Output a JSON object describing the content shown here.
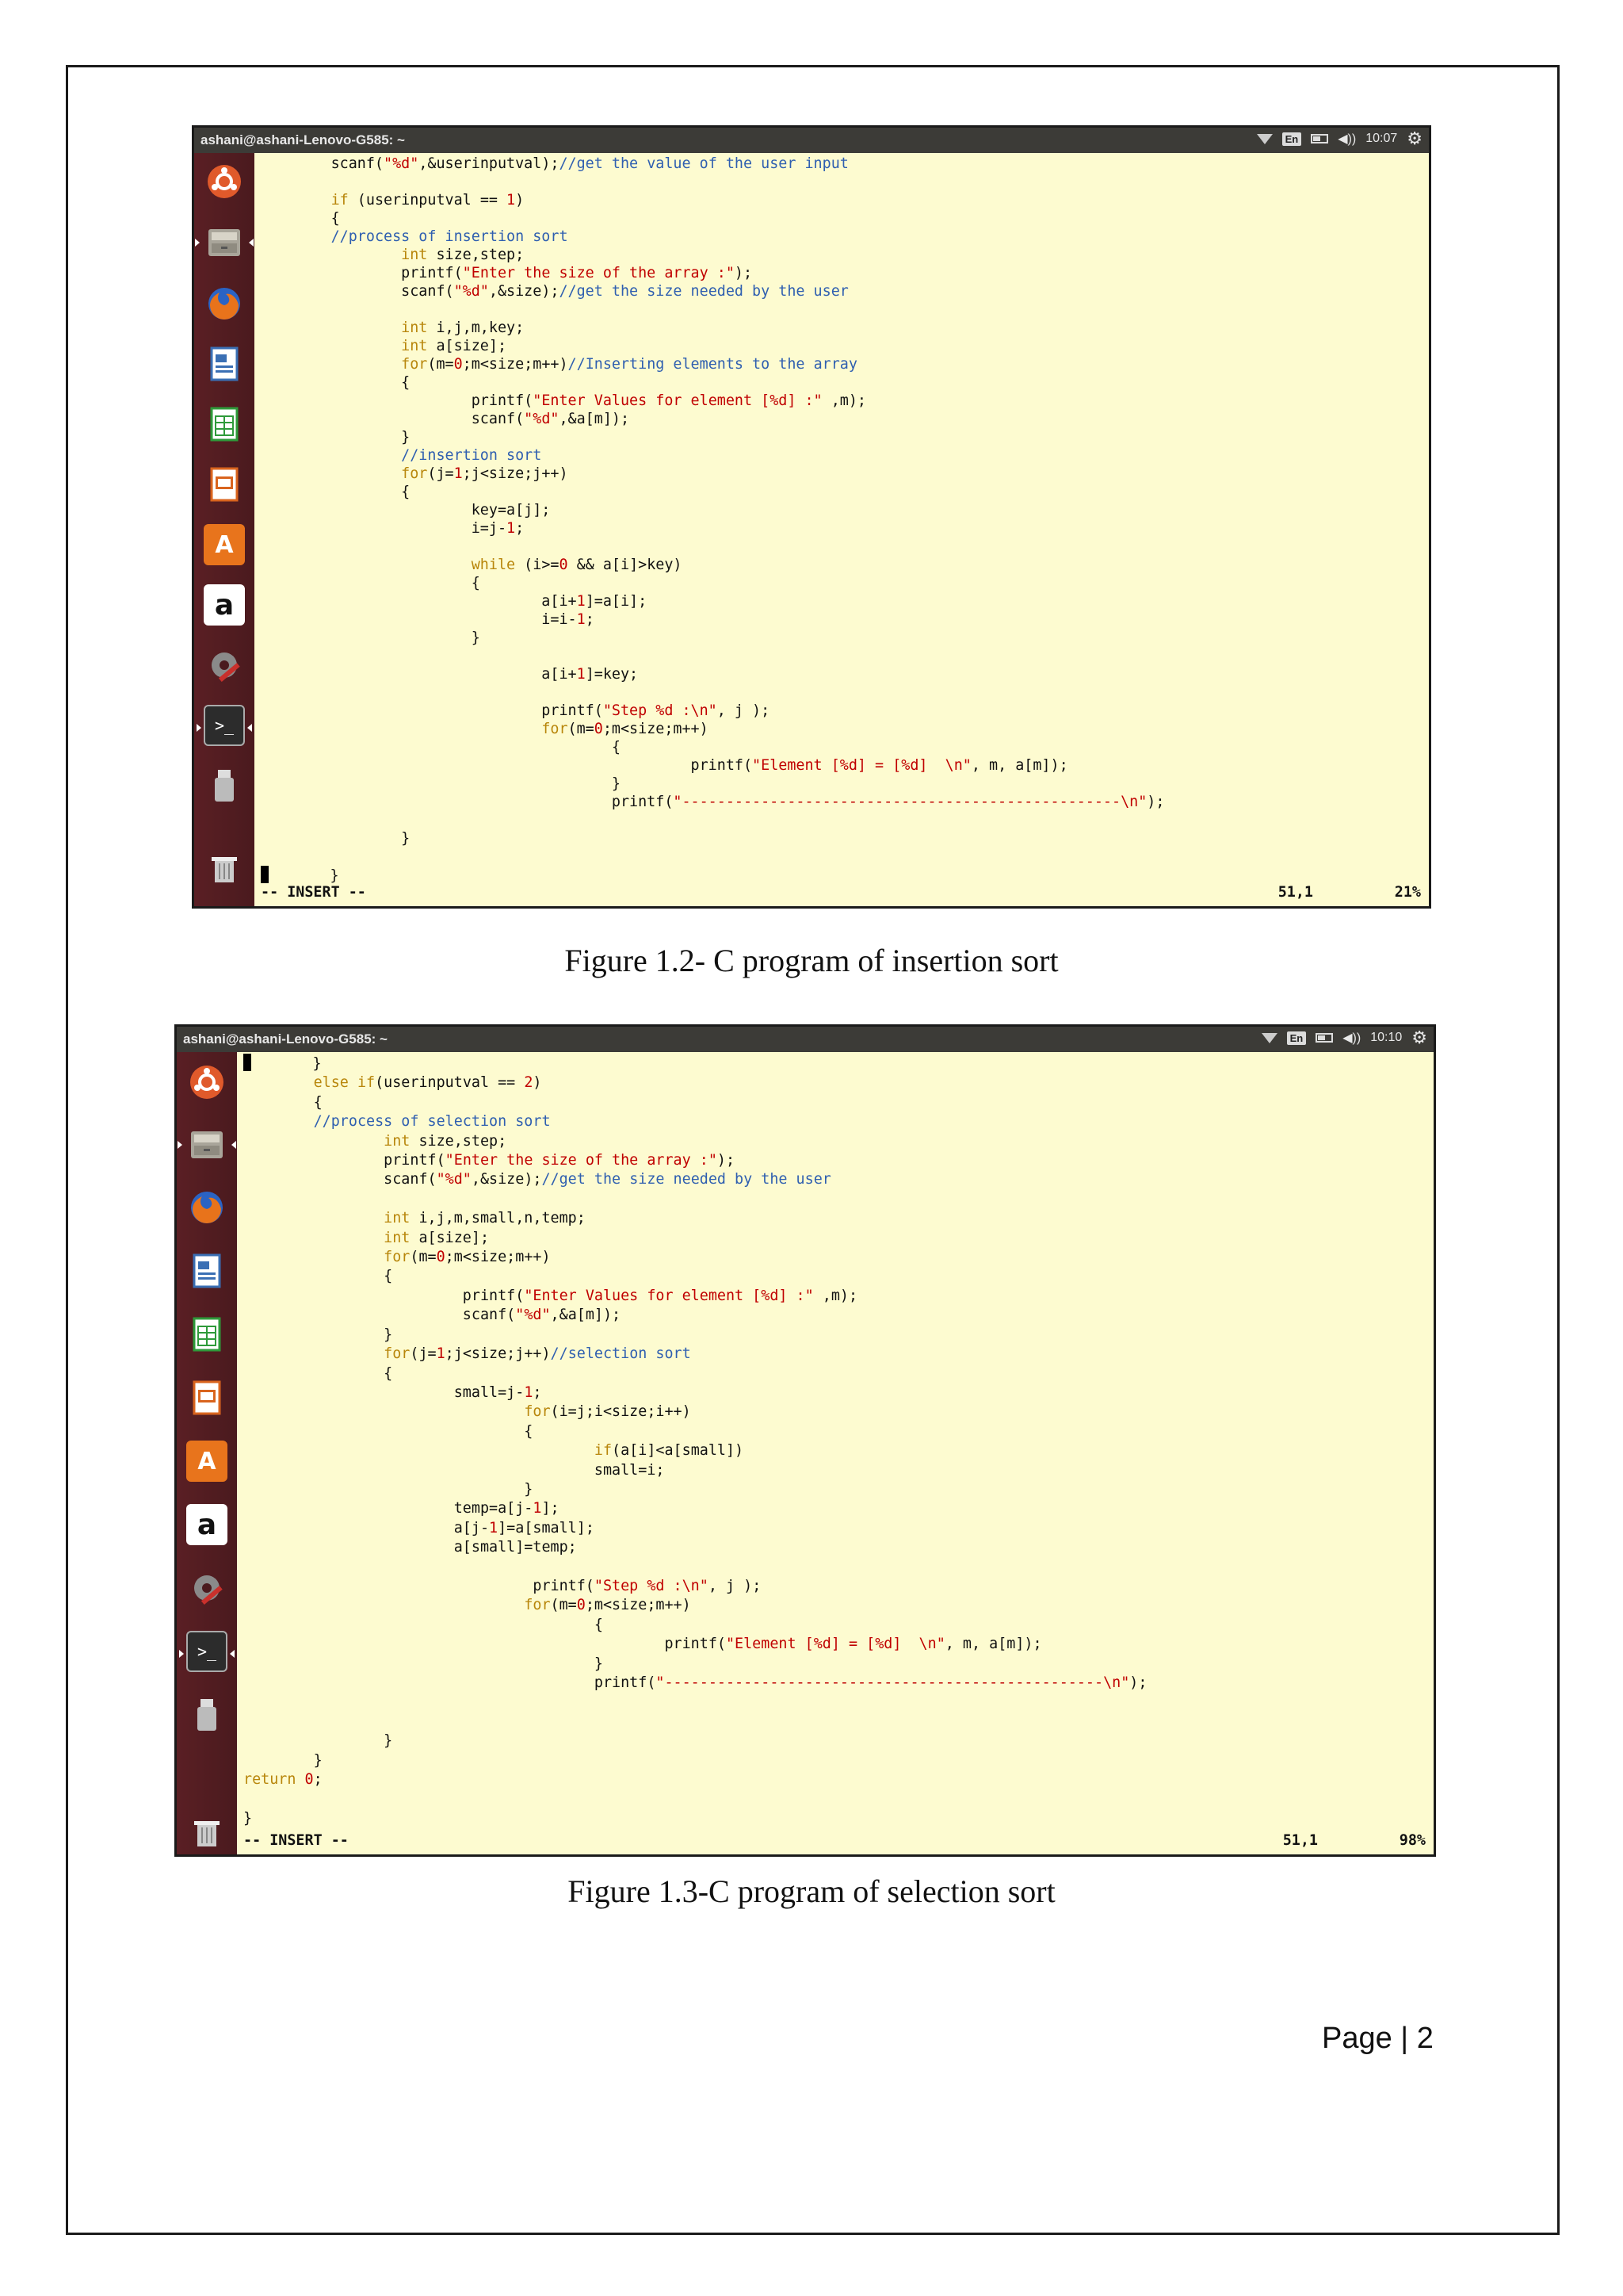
{
  "figures": [
    {
      "window": {
        "host": "ashani@ashani-Lenovo-G585: ~",
        "lang": "En",
        "volume_glyph": "◀))",
        "time": "10:07",
        "settings_glyph": "⚙"
      },
      "status": {
        "mode": "-- INSERT --",
        "position": "51,1",
        "percent": "21%"
      },
      "caption": "Figure  1.2- C program of insertion  sort"
    },
    {
      "window": {
        "host": "ashani@ashani-Lenovo-G585: ~",
        "lang": "En",
        "volume_glyph": "◀))",
        "time": "10:10",
        "settings_glyph": "⚙"
      },
      "status": {
        "mode": "-- INSERT --",
        "position": "51,1",
        "percent": "98%"
      },
      "caption": "Figure  1.3-C program of selection  sort"
    }
  ],
  "launcher_icons": [
    "ubuntu-dash-icon",
    "files-icon",
    "firefox-icon",
    "writer-icon",
    "calc-icon",
    "impress-icon",
    "software-center-icon",
    "amazon-icon",
    "settings-icon",
    "terminal-icon",
    "usb-drive-icon",
    "trash-icon"
  ],
  "launcher_labels": {
    "software": "A",
    "amazon": "a",
    "terminal": ">_"
  },
  "page_number": "Page | 2"
}
